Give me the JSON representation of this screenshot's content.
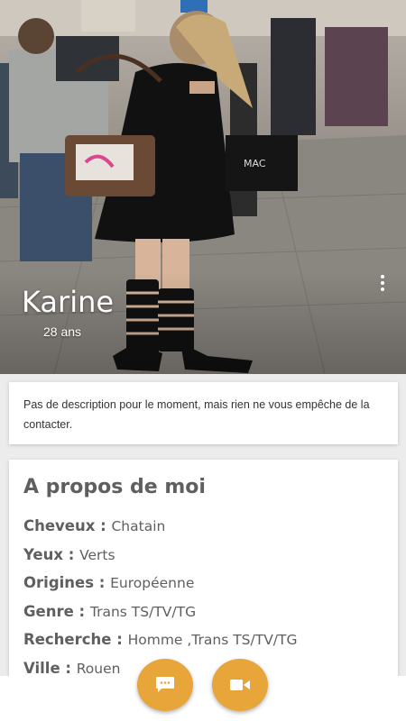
{
  "profile": {
    "name": "Karine",
    "age": "28 ans"
  },
  "description": {
    "text": "Pas de description pour le moment, mais rien ne vous empêche de la contacter."
  },
  "about": {
    "title": "A propos de moi",
    "rows": [
      {
        "key": "Cheveux",
        "value": "Chatain"
      },
      {
        "key": "Yeux",
        "value": "Verts"
      },
      {
        "key": "Origines",
        "value": "Européenne"
      },
      {
        "key": "Genre",
        "value": "Trans TS/TV/TG"
      },
      {
        "key": "Recherche",
        "value": "Homme  ,Trans TS/TV/TG"
      },
      {
        "key": "Ville",
        "value": "Rouen"
      }
    ]
  },
  "photo": {
    "bag_text": "MAC"
  },
  "icons": {
    "more": "more-vertical-icon",
    "chat": "chat-icon",
    "video": "video-camera-icon"
  },
  "colors": {
    "accent": "#e7a53a",
    "text": "#5f5f5f",
    "background": "#ececec"
  }
}
